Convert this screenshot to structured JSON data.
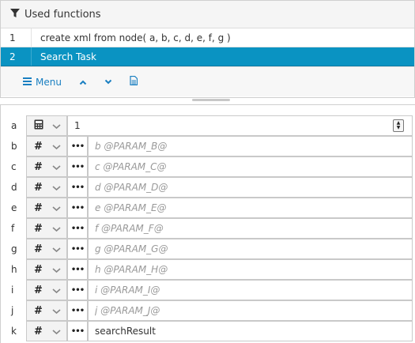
{
  "header": {
    "title": "Used functions"
  },
  "functions": [
    {
      "num": "1",
      "text": "create xml from node( a, b, c, d, e, f, g )"
    },
    {
      "num": "2",
      "text": "Search Task"
    }
  ],
  "toolbar": {
    "menu_label": "Menu"
  },
  "params": [
    {
      "name": "a",
      "type_icon": "calculator-icon",
      "value": "1",
      "placeholder": ""
    },
    {
      "name": "b",
      "type_icon": "hash-icon",
      "value": "",
      "placeholder": "b @PARAM_B@"
    },
    {
      "name": "c",
      "type_icon": "hash-icon",
      "value": "",
      "placeholder": "c @PARAM_C@"
    },
    {
      "name": "d",
      "type_icon": "hash-icon",
      "value": "",
      "placeholder": "d @PARAM_D@"
    },
    {
      "name": "e",
      "type_icon": "hash-icon",
      "value": "",
      "placeholder": "e @PARAM_E@"
    },
    {
      "name": "f",
      "type_icon": "hash-icon",
      "value": "",
      "placeholder": "f @PARAM_F@"
    },
    {
      "name": "g",
      "type_icon": "hash-icon",
      "value": "",
      "placeholder": "g @PARAM_G@"
    },
    {
      "name": "h",
      "type_icon": "hash-icon",
      "value": "",
      "placeholder": "h @PARAM_H@"
    },
    {
      "name": "i",
      "type_icon": "hash-icon",
      "value": "",
      "placeholder": "i @PARAM_I@"
    },
    {
      "name": "j",
      "type_icon": "hash-icon",
      "value": "",
      "placeholder": "j @PARAM_J@"
    },
    {
      "name": "k",
      "type_icon": "hash-icon",
      "value": "searchResult",
      "placeholder": ""
    }
  ],
  "colors": {
    "selected_row": "#0a93c2",
    "accent": "#1a7fc1"
  }
}
